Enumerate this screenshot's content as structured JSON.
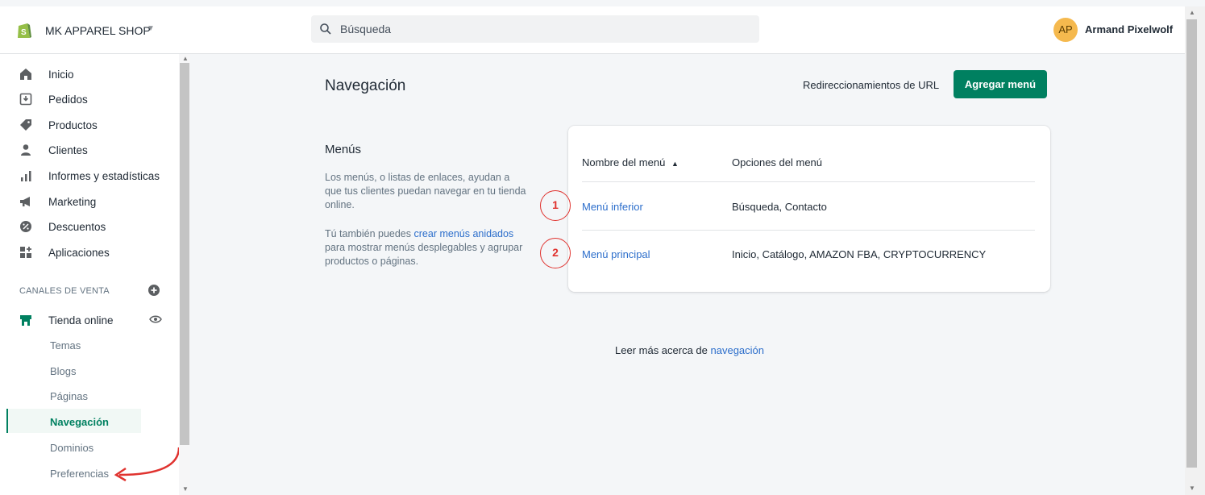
{
  "topbar": {
    "store_name": "MK APPAREL SHOP",
    "search_placeholder": "Búsqueda",
    "user_initials": "AP",
    "user_name": "Armand Pixelwolf"
  },
  "sidebar": {
    "items": [
      {
        "label": "Inicio",
        "icon": "home-icon"
      },
      {
        "label": "Pedidos",
        "icon": "orders-icon"
      },
      {
        "label": "Productos",
        "icon": "tag-icon"
      },
      {
        "label": "Clientes",
        "icon": "person-icon"
      },
      {
        "label": "Informes y estadísticas",
        "icon": "bar-chart-icon"
      },
      {
        "label": "Marketing",
        "icon": "megaphone-icon"
      },
      {
        "label": "Descuentos",
        "icon": "discount-icon"
      },
      {
        "label": "Aplicaciones",
        "icon": "apps-icon"
      }
    ],
    "section_label": "CANALES DE VENTA",
    "channel": {
      "label": "Tienda online",
      "icon": "store-icon"
    },
    "sub_items": [
      "Temas",
      "Blogs",
      "Páginas",
      "Navegación",
      "Dominios",
      "Preferencias"
    ],
    "active_sub_item": "Navegación"
  },
  "main": {
    "title": "Navegación",
    "redirects_label": "Redireccionamientos de URL",
    "add_menu_label": "Agregar menú",
    "menus_title": "Menús",
    "menus_description": "Los menús, o listas de enlaces, ayudan a que tus clientes puedan navegar en tu tienda online.",
    "nested_prefix": "Tú también puedes ",
    "nested_link": "crear menús anidados",
    "nested_suffix": " para mostrar menús desplegables y agrupar productos o páginas.",
    "table": {
      "col_name": "Nombre del menú",
      "col_options": "Opciones del menú",
      "rows": [
        {
          "badge": "1",
          "name": "Menú inferior",
          "options": "Búsqueda, Contacto"
        },
        {
          "badge": "2",
          "name": "Menú principal",
          "options": "Inicio, Catálogo, AMAZON FBA, CRYPTOCURRENCY"
        }
      ]
    },
    "learn_more_prefix": "Leer más acerca de ",
    "learn_more_link": "navegación"
  },
  "colors": {
    "accent": "#008060",
    "link": "#2c6ecb",
    "annotation": "#e0332f"
  }
}
